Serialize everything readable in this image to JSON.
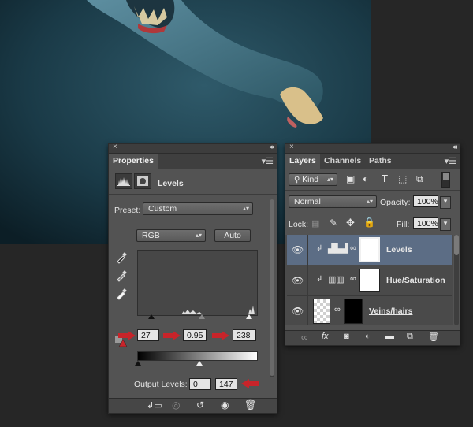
{
  "properties": {
    "tab": "Properties",
    "adjustment_name": "Levels",
    "preset_label": "Preset:",
    "preset_value": "Custom",
    "channel_value": "RGB",
    "auto_label": "Auto",
    "input_shadow": "27",
    "input_midtone": "0.95",
    "input_highlight": "238",
    "output_label": "Output Levels:",
    "output_black": "0",
    "output_white": "147"
  },
  "layers": {
    "tabs": [
      "Layers",
      "Channels",
      "Paths"
    ],
    "filter_value": "Kind",
    "blend_mode": "Normal",
    "opacity_label": "Opacity:",
    "opacity_value": "100%",
    "lock_label": "Lock:",
    "fill_label": "Fill:",
    "fill_value": "100%",
    "items": [
      {
        "name": "Levels",
        "selected": true
      },
      {
        "name": "Hue/Saturation",
        "selected": false
      },
      {
        "name": "Veins/hairs",
        "selected": false
      }
    ]
  },
  "colors": {
    "accent_arrow": "#c8242a",
    "selected_layer": "#5c6d85",
    "panel_bg": "#535353"
  }
}
